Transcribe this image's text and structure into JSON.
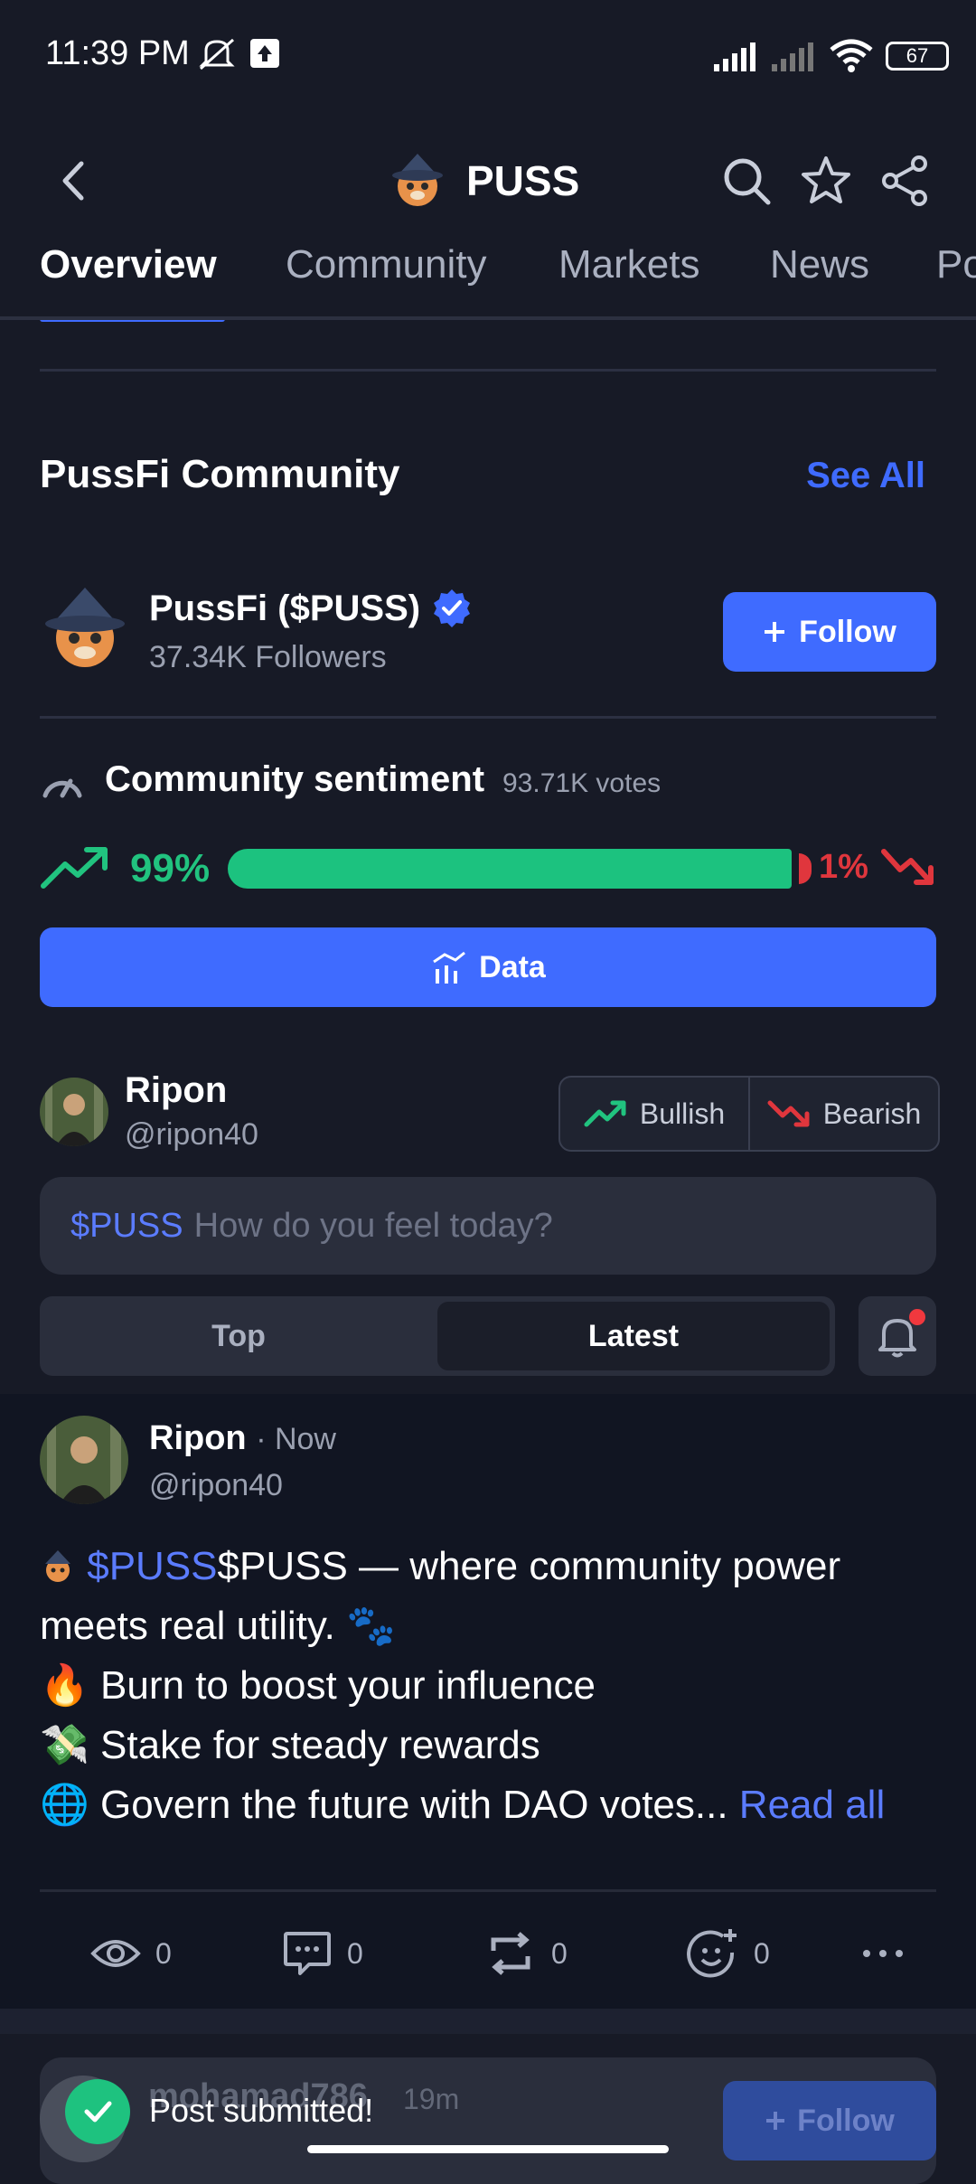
{
  "status_bar": {
    "time": "11:39 PM",
    "battery": "67"
  },
  "header": {
    "title": "PUSS"
  },
  "tabs": [
    {
      "label": "Overview"
    },
    {
      "label": "Community"
    },
    {
      "label": "Markets"
    },
    {
      "label": "News"
    },
    {
      "label": "Po"
    }
  ],
  "community": {
    "section_title": "PussFi Community",
    "see_all": "See All",
    "name": "PussFi ($PUSS)",
    "followers": "37.34K Followers",
    "follow_label": "Follow"
  },
  "sentiment": {
    "title": "Community sentiment",
    "votes": "93.71K votes",
    "bullish_pct_label": "99%",
    "bearish_pct_label": "1%",
    "bullish_fraction": 0.99,
    "data_button": "Data",
    "colors": {
      "bullish": "#1cc27f",
      "bearish": "#e0363d",
      "accent": "#3f6bff"
    }
  },
  "composer": {
    "user_name": "Ripon",
    "user_handle": "@ripon40",
    "bullish_label": "Bullish",
    "bearish_label": "Bearish",
    "ticker": "$PUSS",
    "placeholder": "How do you feel today?"
  },
  "sort": {
    "top": "Top",
    "latest": "Latest"
  },
  "post": {
    "author": "Ripon",
    "time": "· Now",
    "handle": "@ripon40",
    "lines": [
      {
        "ticker": "$PUSS",
        "text": "$PUSS — where community power"
      },
      {
        "text": "meets real utility. 🐾"
      },
      {
        "emoji": "🔥",
        "text": "Burn to boost your influence"
      },
      {
        "emoji": "💸",
        "text": "Stake for steady rewards"
      },
      {
        "emoji": "🌐",
        "text": "Govern the future with DAO votes..."
      }
    ],
    "read_all": "Read all",
    "views": "0",
    "comments": "0",
    "reposts": "0",
    "reactions": "0"
  },
  "next_post": {
    "author": "mohamad786",
    "time": "19m",
    "follow_label": "Follow"
  },
  "toast": {
    "text": "Post submitted!"
  }
}
